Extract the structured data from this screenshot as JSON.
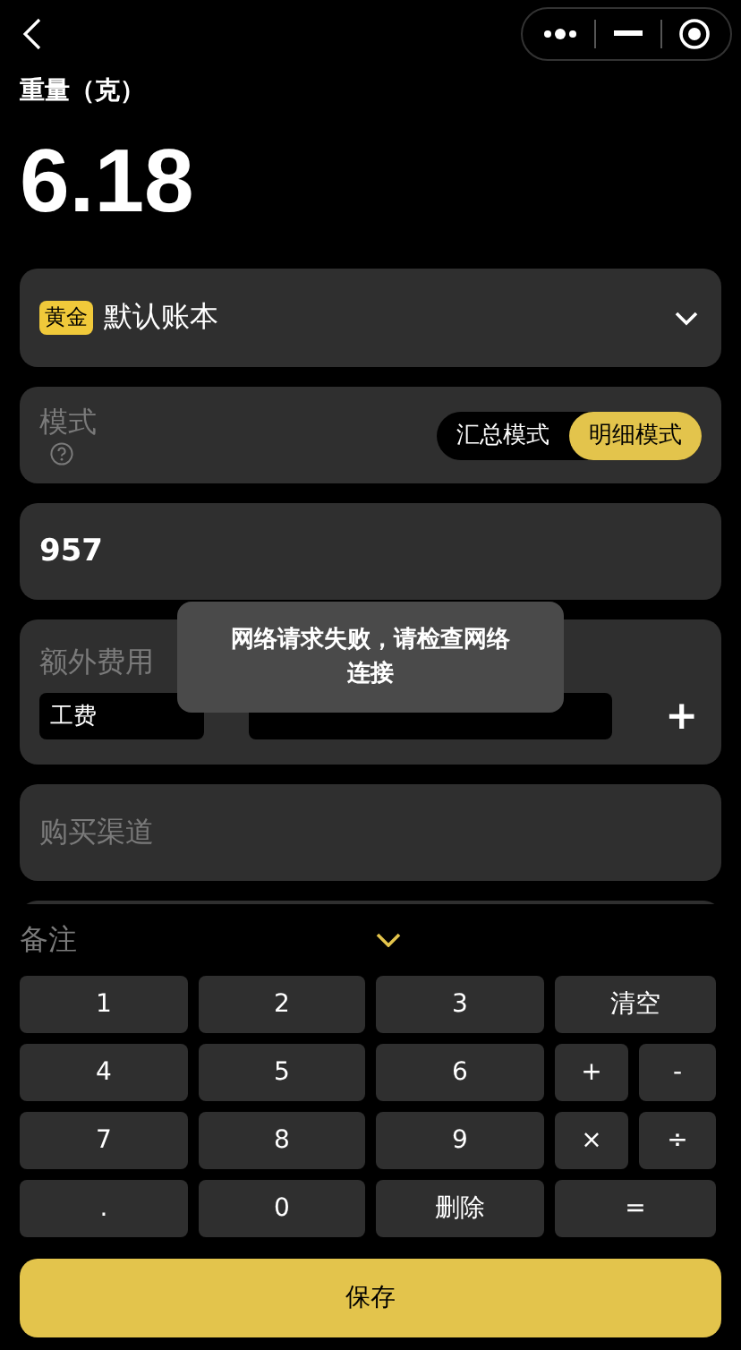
{
  "header": {
    "weight_label": "重量（克）",
    "weight_value": "6.18"
  },
  "account": {
    "tag": "黄金",
    "name": "默认账本"
  },
  "mode": {
    "label": "模式",
    "options": [
      {
        "label": "汇总模式",
        "selected": false
      },
      {
        "label": "明细模式",
        "selected": true
      }
    ]
  },
  "price": {
    "value": "957"
  },
  "extra_fee": {
    "label": "额外费用",
    "type": "工费",
    "add": "+"
  },
  "channel": {
    "placeholder": "购买渠道"
  },
  "toast": {
    "message": "网络请求失败，请检查网络连接"
  },
  "note": {
    "label": "备注"
  },
  "keypad": [
    {
      "label": "1",
      "kind": "key"
    },
    {
      "label": "2",
      "kind": "key"
    },
    {
      "label": "3",
      "kind": "key"
    },
    {
      "label": "清空",
      "kind": "wide"
    },
    {
      "label": "4",
      "kind": "key"
    },
    {
      "label": "5",
      "kind": "key"
    },
    {
      "label": "6",
      "kind": "key"
    },
    {
      "label": "+",
      "kind": "key"
    },
    {
      "label": "-",
      "kind": "key"
    },
    {
      "label": "7",
      "kind": "key"
    },
    {
      "label": "8",
      "kind": "key"
    },
    {
      "label": "9",
      "kind": "key"
    },
    {
      "label": "×",
      "kind": "key"
    },
    {
      "label": "÷",
      "kind": "key"
    },
    {
      "label": ".",
      "kind": "key"
    },
    {
      "label": "0",
      "kind": "key"
    },
    {
      "label": "删除",
      "kind": "key"
    },
    {
      "label": "=",
      "kind": "wide"
    }
  ],
  "save": "保存"
}
